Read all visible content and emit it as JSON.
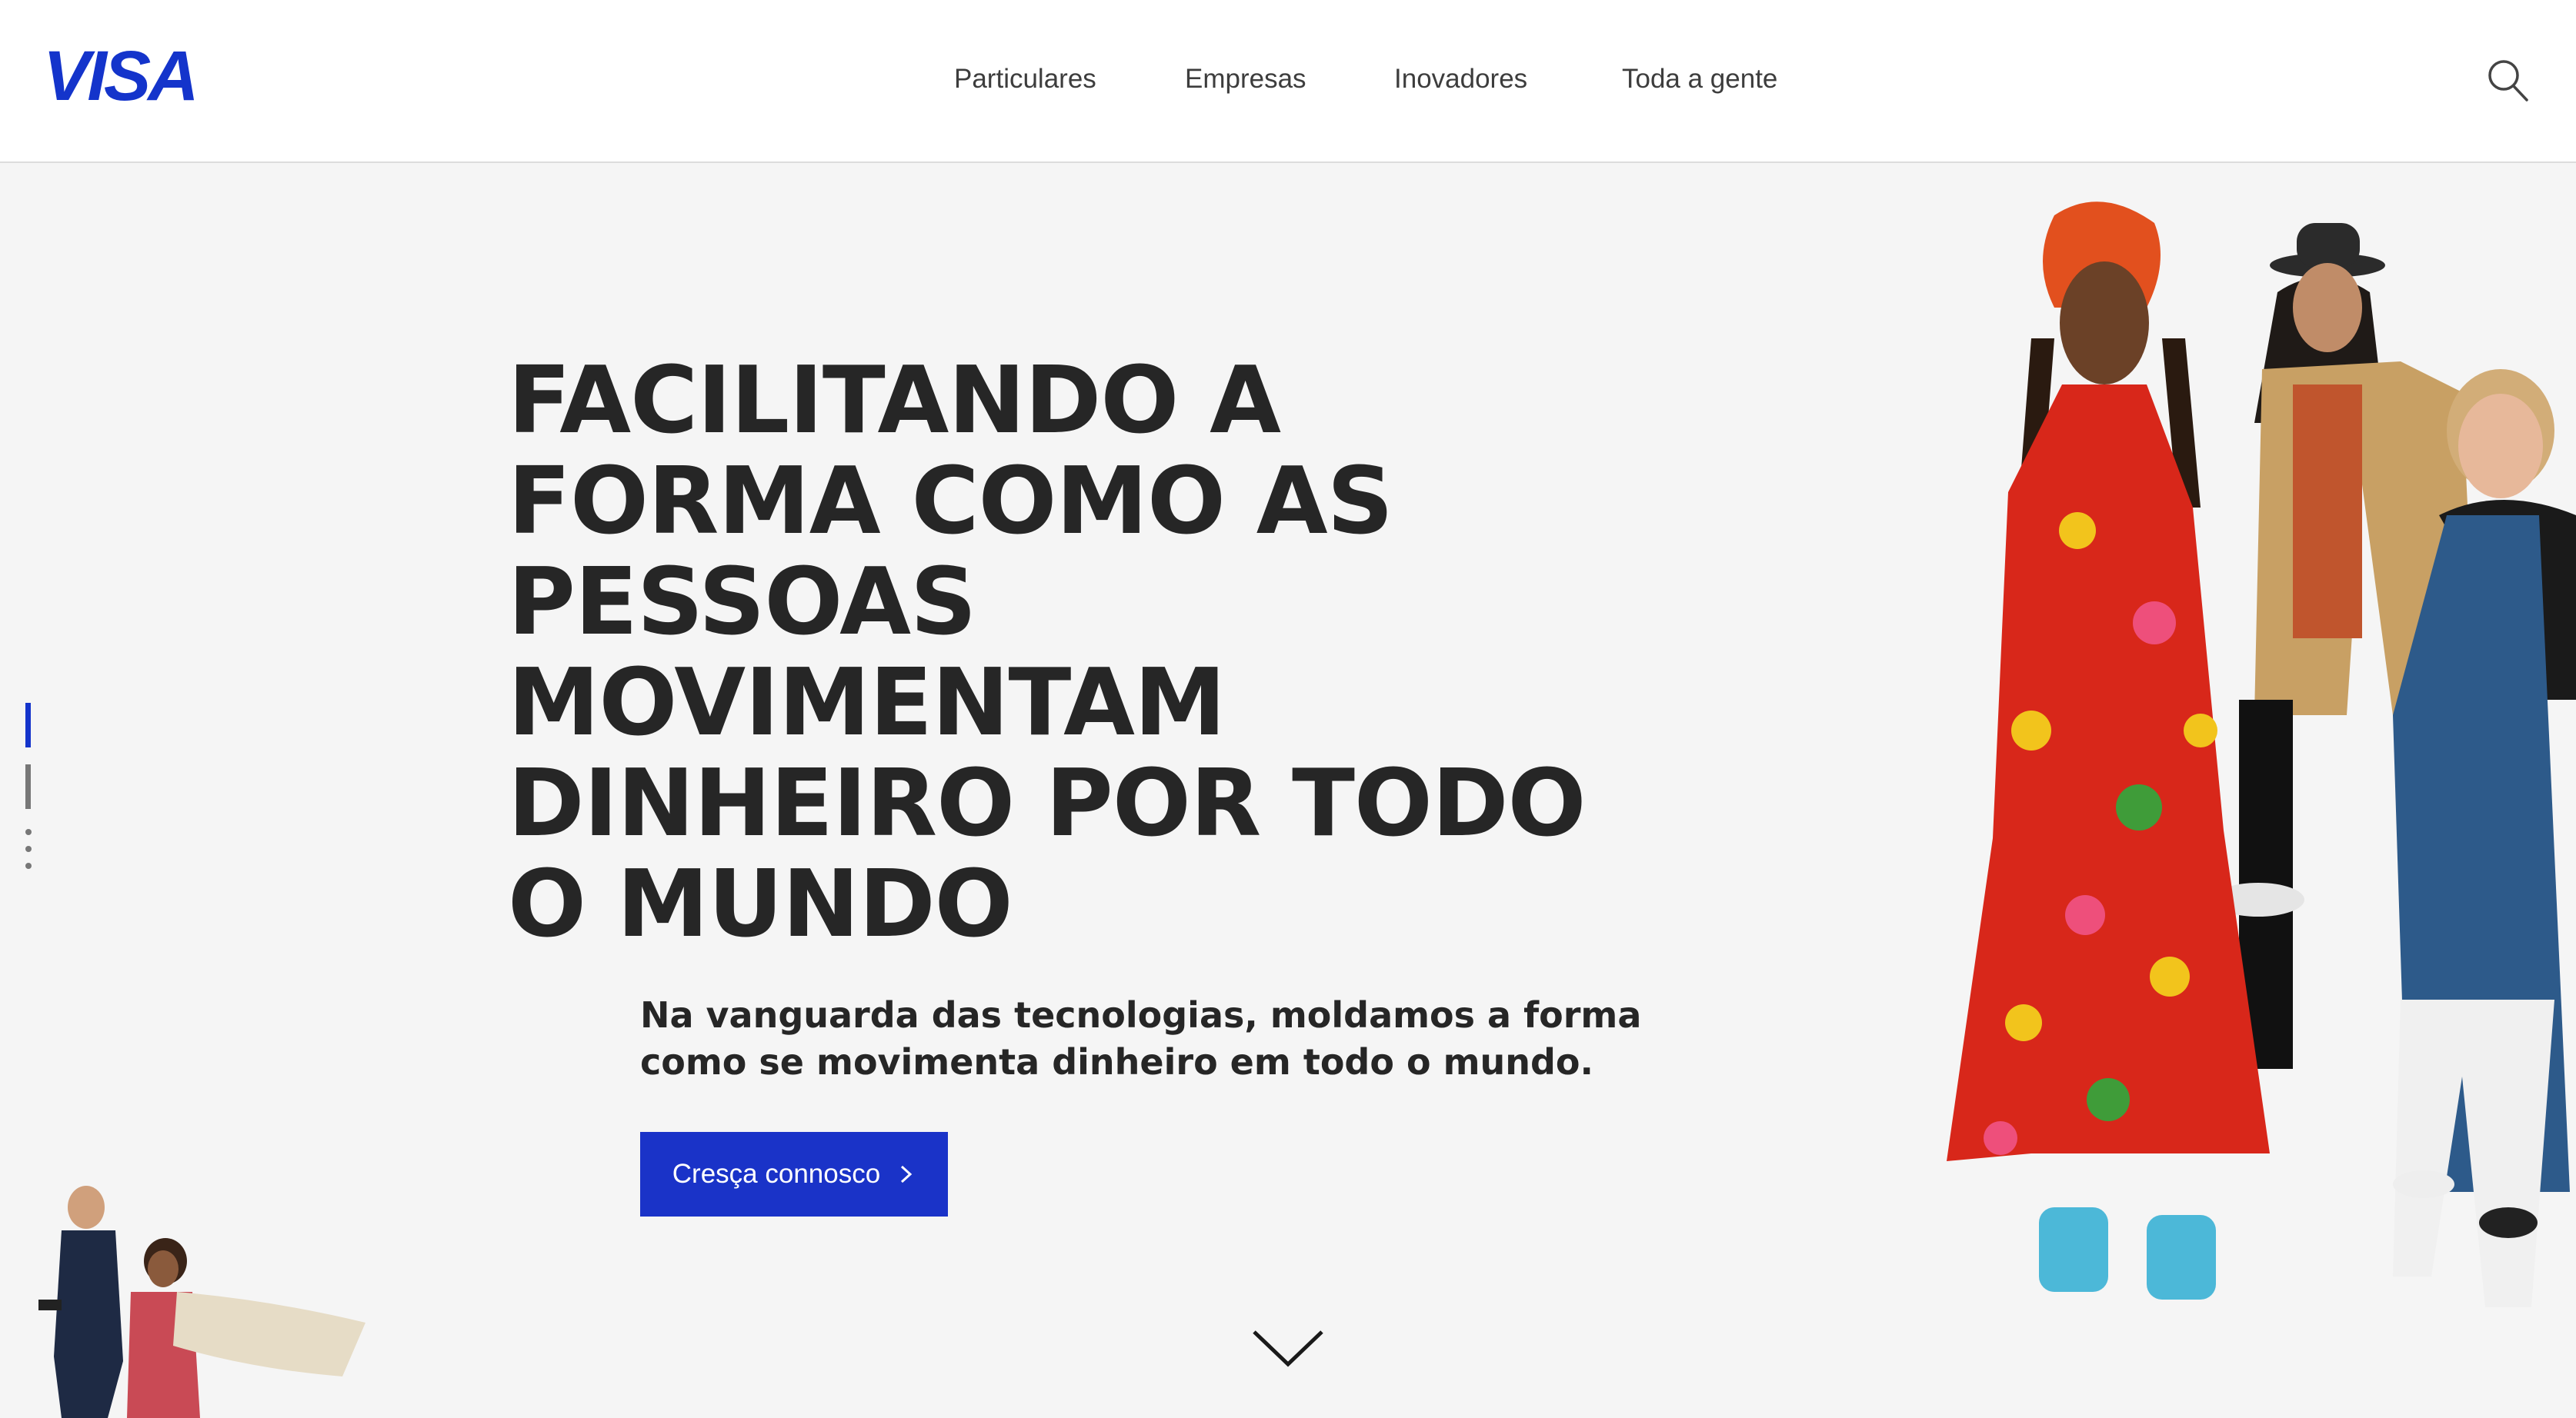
{
  "brand": {
    "logo_text": "VISA",
    "color_dark": "#1a1f71",
    "color_accent": "#1434cb"
  },
  "nav": {
    "items": [
      {
        "label": "Particulares"
      },
      {
        "label": "Empresas"
      },
      {
        "label": "Inovadores"
      },
      {
        "label": "Toda a gente"
      }
    ],
    "search_icon": "search-icon"
  },
  "hero": {
    "title": "FACILITANDO A FORMA COMO AS PESSOAS MOVIMENTAM DINHEIRO POR TODO O MUNDO",
    "subtitle": "Na vanguarda das tecnologias, moldamos a forma como se movimenta dinheiro em todo o mundo.",
    "cta_label": "Cresça connosco",
    "cta_color": "#1a33c8",
    "scroll_icon": "chevron-down-icon"
  },
  "pager": {
    "slides": 4,
    "active_index": 0
  }
}
